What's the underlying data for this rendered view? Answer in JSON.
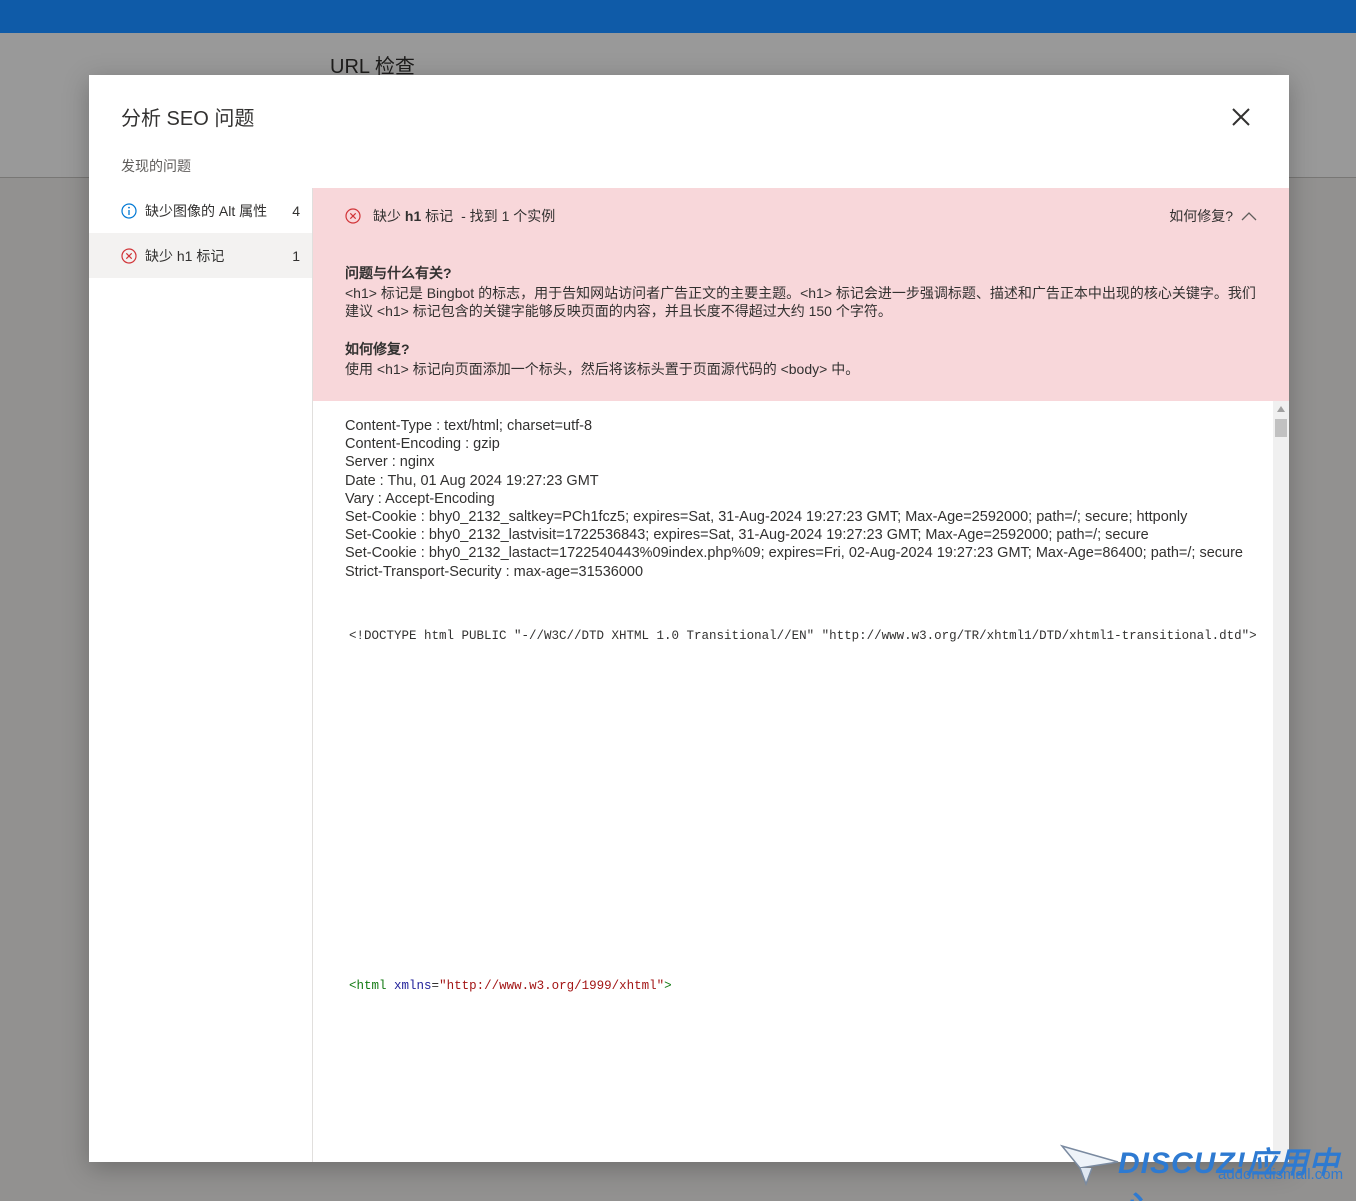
{
  "background": {
    "page_title": "URL 检查"
  },
  "dialog": {
    "title": "分析 SEO 问题",
    "section_label": "发现的问题",
    "issues": [
      {
        "label": "缺少图像的 Alt 属性",
        "count": "4",
        "icon": "info-icon",
        "active": false
      },
      {
        "label": "缺少 h1 标记",
        "count": "1",
        "icon": "error-icon",
        "active": true
      }
    ]
  },
  "detail": {
    "issue_prefix": "缺少 ",
    "issue_bold": "h1",
    "issue_suffix": " 标记",
    "instances": "- 找到 1 个实例",
    "how_fix_toggle": "如何修复?",
    "about_heading": "问题与什么有关?",
    "about_text": "<h1> 标记是 Bingbot 的标志，用于告知网站访问者广告正文的主要主题。<h1> 标记会进一步强调标题、描述和广告正本中出现的核心关键字。我们建议 <h1> 标记包含的关键字能够反映页面的内容，并且长度不得超过大约 150 个字符。",
    "fix_heading": "如何修复?",
    "fix_text": "使用 <h1> 标记向页面添加一个标头，然后将该标头置于页面源代码的 <body> 中。"
  },
  "source": {
    "headers": [
      "Content-Type : text/html; charset=utf-8",
      "Content-Encoding : gzip",
      "Server : nginx",
      "Date : Thu, 01 Aug 2024 19:27:23 GMT",
      "Vary : Accept-Encoding",
      "Set-Cookie : bhy0_2132_saltkey=PCh1fcz5; expires=Sat, 31-Aug-2024 19:27:23 GMT; Max-Age=2592000; path=/; secure; httponly",
      "Set-Cookie : bhy0_2132_lastvisit=1722536843; expires=Sat, 31-Aug-2024 19:27:23 GMT; Max-Age=2592000; path=/; secure",
      "Set-Cookie : bhy0_2132_lastact=1722540443%09index.php%09; expires=Fri, 02-Aug-2024 19:27:23 GMT; Max-Age=86400; path=/; secure",
      "Strict-Transport-Security : max-age=31536000"
    ],
    "doctype": "<!DOCTYPE html PUBLIC \"-//W3C//DTD XHTML 1.0 Transitional//EN\" \"http://www.w3.org/TR/xhtml1/DTD/xhtml1-transitional.dtd\">",
    "html_open": "<html",
    "html_attr": "xmlns",
    "html_eq": "=",
    "html_val": "\"http://www.w3.org/1999/xhtml\"",
    "html_close": ">"
  },
  "watermark": {
    "logo": "DISCUZ!应用中心",
    "url": "addon.dismall.com"
  },
  "colors": {
    "topbar": "#0f5ba8",
    "issue_bg": "#f8d7da",
    "error_icon": "#d13438",
    "info_icon": "#0078d4"
  }
}
